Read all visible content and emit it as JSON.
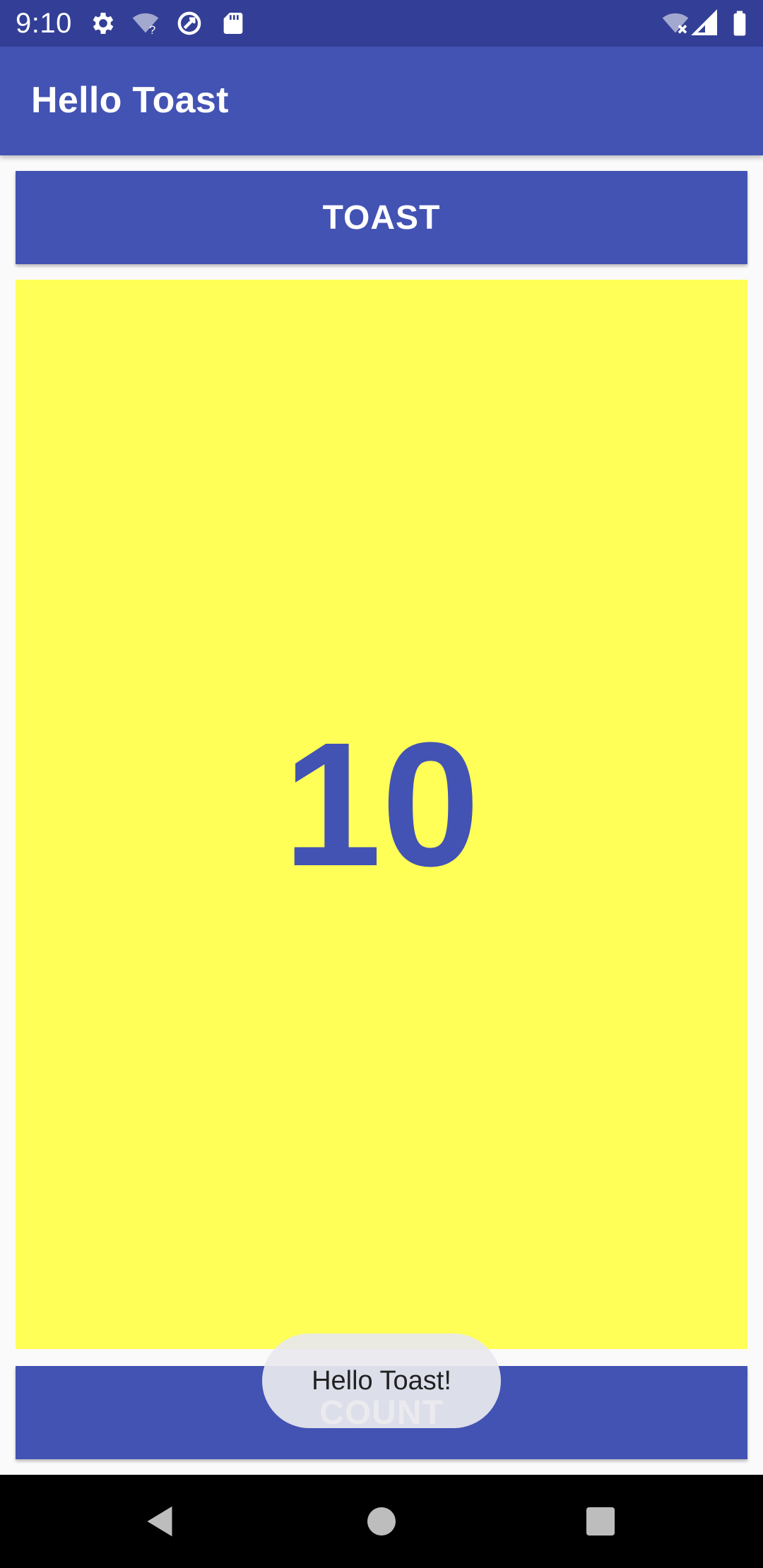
{
  "status_bar": {
    "time": "9:10",
    "left_icons": [
      "gear-icon",
      "wifi-unknown-icon",
      "data-saver-icon",
      "sd-card-icon"
    ],
    "right_icons": [
      "wifi-off-icon",
      "cell-signal-icon",
      "battery-icon"
    ]
  },
  "app_bar": {
    "title": "Hello Toast"
  },
  "toast_button": {
    "label": "TOAST"
  },
  "counter": {
    "value": "10"
  },
  "count_button": {
    "label": "COUNT"
  },
  "toast_message": {
    "text": "Hello Toast!"
  },
  "nav_bar": {
    "buttons": [
      "back-icon",
      "home-icon",
      "recents-icon"
    ]
  },
  "colors": {
    "status_bar": "#333f96",
    "primary": "#4353b3",
    "count_background": "#ffff57",
    "toast_background": "#e8e8ee",
    "nav_bar": "#000000"
  }
}
